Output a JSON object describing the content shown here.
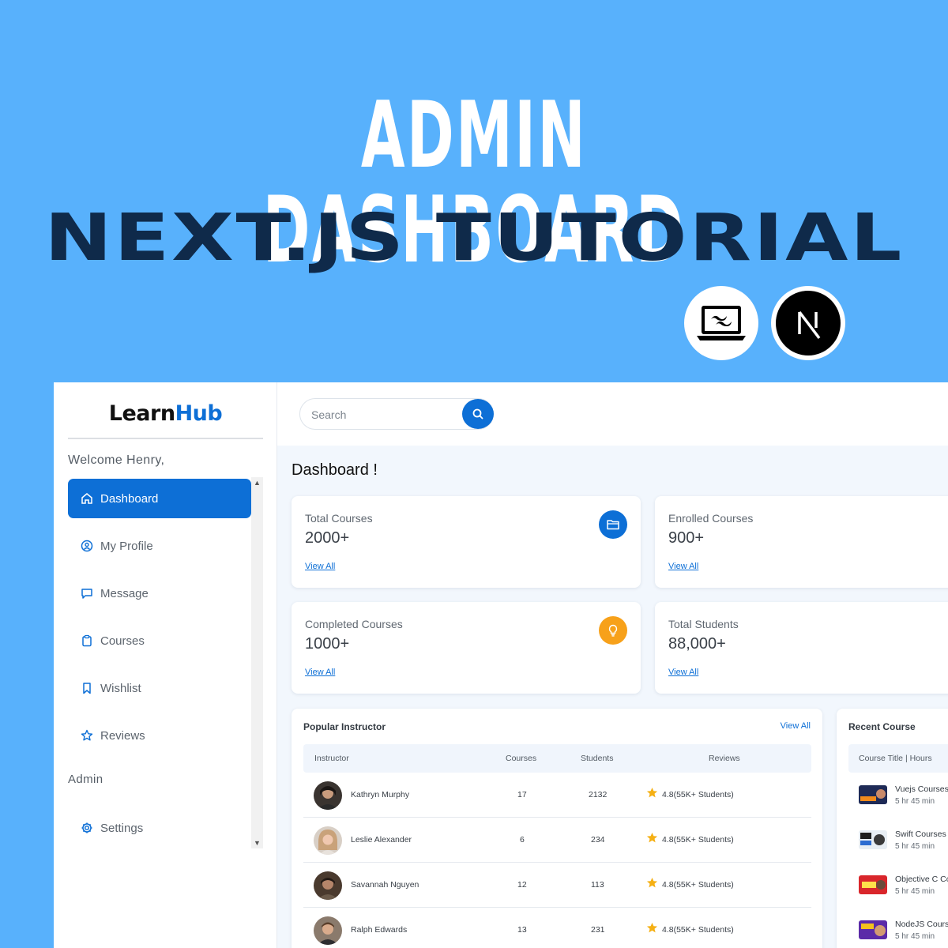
{
  "banner": {
    "title": "ADMIN DASHBOARD",
    "subtitle": "NEXT.JS TUTORIAL",
    "logos": [
      "tailwind-laptop-icon",
      "nextjs-icon"
    ]
  },
  "brand": {
    "learn": "Learn",
    "hub": "Hub"
  },
  "sidebar": {
    "welcome": "Welcome Henry,",
    "items": [
      {
        "label": "Dashboard",
        "icon": "home-icon",
        "active": true
      },
      {
        "label": "My Profile",
        "icon": "user-circle-icon"
      },
      {
        "label": "Message",
        "icon": "message-icon"
      },
      {
        "label": "Courses",
        "icon": "clipboard-icon"
      },
      {
        "label": "Wishlist",
        "icon": "bookmark-icon"
      },
      {
        "label": "Reviews",
        "icon": "star-outline-icon"
      }
    ],
    "admin_section": "Admin",
    "admin_items": [
      {
        "label": "Settings",
        "icon": "gear-icon"
      }
    ]
  },
  "search": {
    "placeholder": "Search"
  },
  "page_title": "Dashboard !",
  "stats": [
    {
      "label": "Total Courses",
      "value": "2000+",
      "link": "View All",
      "icon": "folder-icon",
      "icon_color": "#0d6fd6"
    },
    {
      "label": "Enrolled Courses",
      "value": "900+",
      "link": "View All"
    },
    {
      "label": "Completed Courses",
      "value": "1000+",
      "link": "View All",
      "icon": "lightbulb-icon",
      "icon_color": "#f7a11a"
    },
    {
      "label": "Total Students",
      "value": "88,000+",
      "link": "View All"
    }
  ],
  "popular": {
    "title": "Popular Instructor",
    "view_all": "View All",
    "headers": {
      "instructor": "Instructor",
      "courses": "Courses",
      "students": "Students",
      "reviews": "Reviews"
    },
    "rows": [
      {
        "name": "Kathryn Murphy",
        "courses": "17",
        "students": "2132",
        "reviews": "4.8(55K+ Students)"
      },
      {
        "name": "Leslie Alexander",
        "courses": "6",
        "students": "234",
        "reviews": "4.8(55K+ Students)"
      },
      {
        "name": "Savannah Nguyen",
        "courses": "12",
        "students": "113",
        "reviews": "4.8(55K+ Students)"
      },
      {
        "name": "Ralph Edwards",
        "courses": "13",
        "students": "231",
        "reviews": "4.8(55K+ Students)"
      }
    ]
  },
  "recent": {
    "title": "Recent Course",
    "header": "Course Title | Hours",
    "rows": [
      {
        "title": "Vuejs Courses",
        "hours": "5 hr 45 min"
      },
      {
        "title": "Swift Courses",
        "hours": "5 hr 45 min"
      },
      {
        "title": "Objective C Co",
        "hours": "5 hr 45 min"
      },
      {
        "title": "NodeJS Cours",
        "hours": "5 hr 45 min"
      }
    ]
  },
  "colors": {
    "background": "#58b1fc",
    "accent": "#0d6fd6",
    "orange": "#f7a11a",
    "navy": "#0f2a4a"
  }
}
